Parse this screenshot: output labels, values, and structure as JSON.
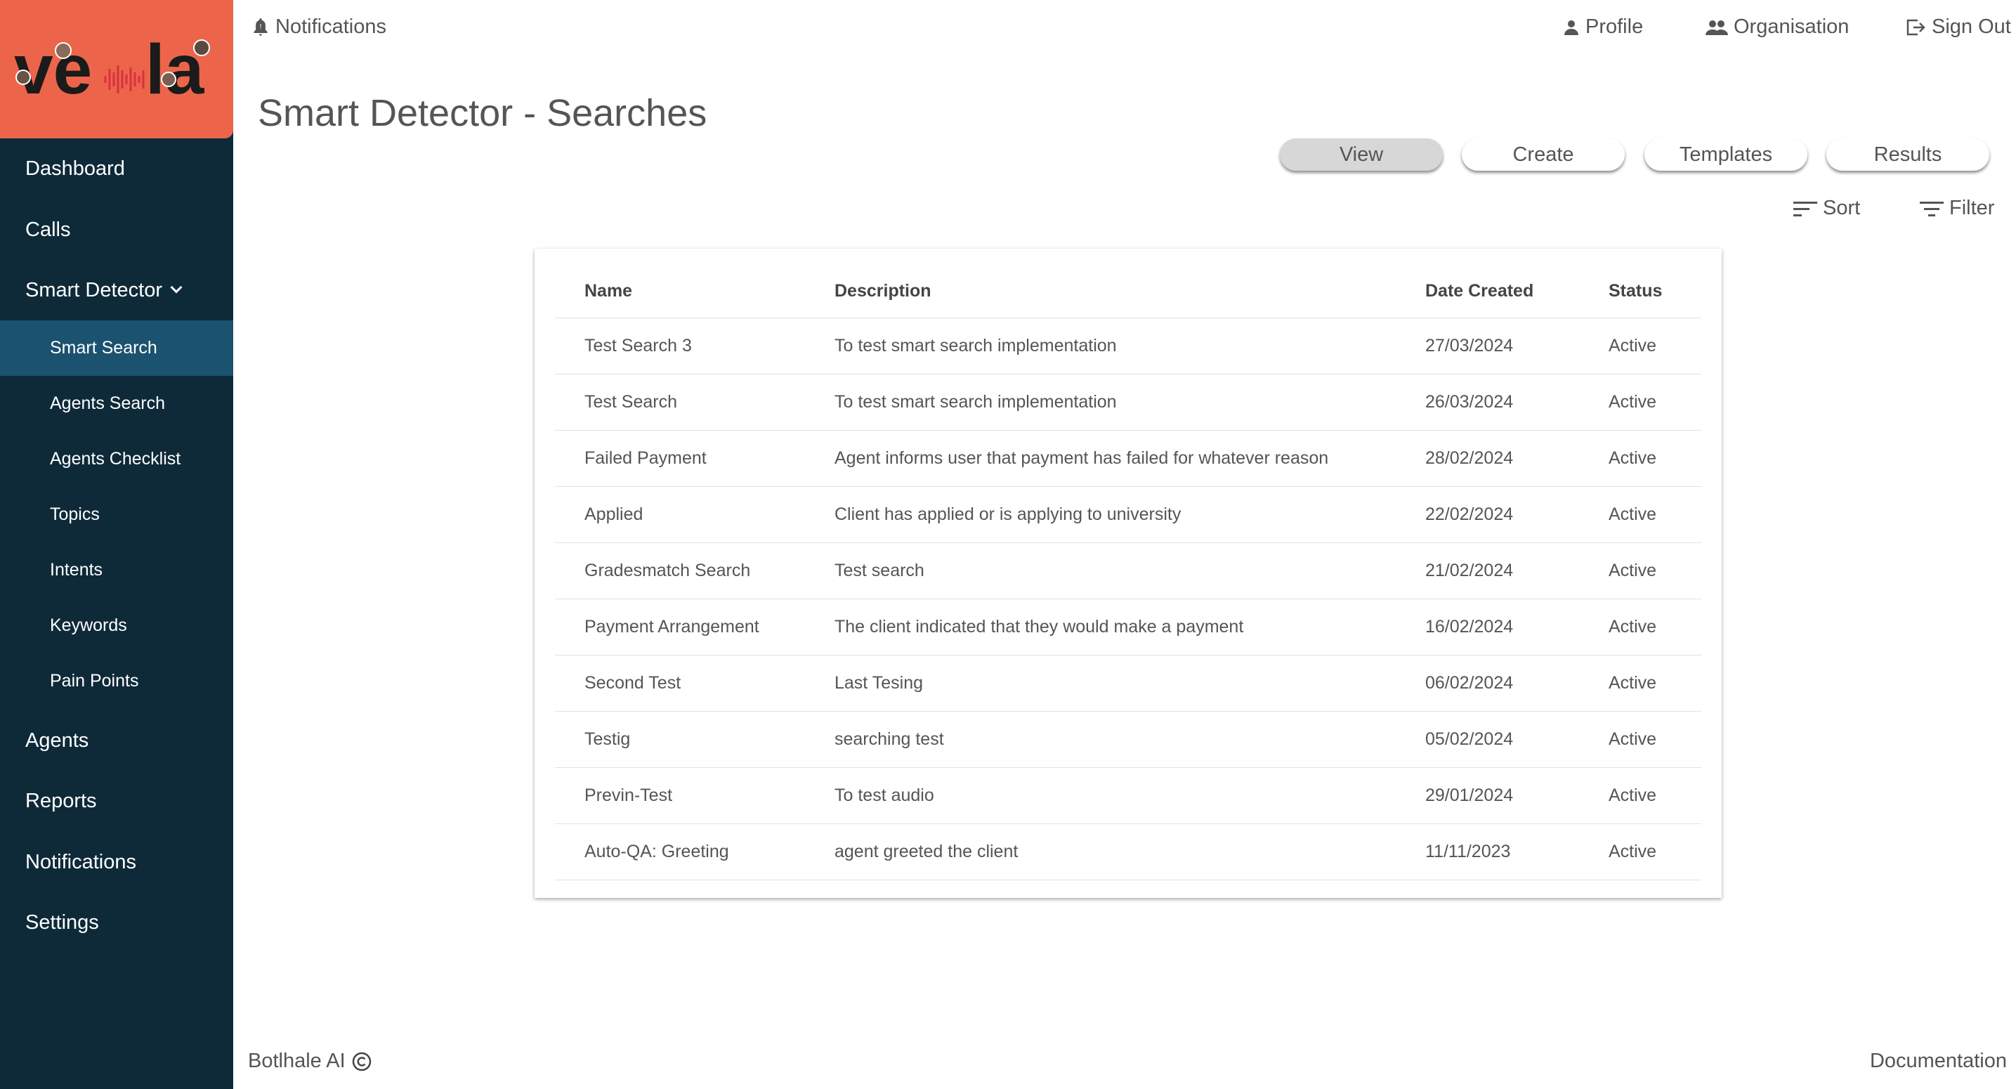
{
  "brand": {
    "logo_text": "vela",
    "logo_color": "#ec654b",
    "sidebar_color": "#0e2a39",
    "active_color": "#1a5270"
  },
  "topbar": {
    "notifications": "Notifications",
    "profile": "Profile",
    "organisation": "Organisation",
    "sign_out": "Sign Out"
  },
  "sidebar": {
    "items": [
      {
        "label": "Dashboard"
      },
      {
        "label": "Calls"
      },
      {
        "label": "Smart Detector"
      },
      {
        "label": "Agents"
      },
      {
        "label": "Reports"
      },
      {
        "label": "Notifications"
      },
      {
        "label": "Settings"
      }
    ],
    "sub_items": [
      {
        "label": "Smart Search",
        "active": true
      },
      {
        "label": "Agents Search"
      },
      {
        "label": "Agents Checklist"
      },
      {
        "label": "Topics"
      },
      {
        "label": "Intents"
      },
      {
        "label": "Keywords"
      },
      {
        "label": "Pain Points"
      }
    ]
  },
  "page": {
    "title": "Smart Detector - Searches"
  },
  "tabs": [
    {
      "label": "View",
      "active": true
    },
    {
      "label": "Create"
    },
    {
      "label": "Templates"
    },
    {
      "label": "Results"
    }
  ],
  "tools": {
    "sort": "Sort",
    "filter": "Filter"
  },
  "table": {
    "columns": [
      "Name",
      "Description",
      "Date Created",
      "Status"
    ],
    "rows": [
      [
        "Test Search 3",
        "To test smart search implementation",
        "27/03/2024",
        "Active"
      ],
      [
        "Test Search",
        "To test smart search implementation",
        "26/03/2024",
        "Active"
      ],
      [
        "Failed Payment",
        "Agent informs user that payment has failed for whatever reason",
        "28/02/2024",
        "Active"
      ],
      [
        "Applied",
        "Client has applied or is applying to university",
        "22/02/2024",
        "Active"
      ],
      [
        "Gradesmatch Search",
        "Test search",
        "21/02/2024",
        "Active"
      ],
      [
        "Payment Arrangement",
        "The client indicated that they would make a payment",
        "16/02/2024",
        "Active"
      ],
      [
        "Second Test",
        "Last Tesing",
        "06/02/2024",
        "Active"
      ],
      [
        "Testig",
        "searching test",
        "05/02/2024",
        "Active"
      ],
      [
        "Previn-Test",
        "To test audio",
        "29/01/2024",
        "Active"
      ],
      [
        "Auto-QA: Greeting",
        "agent greeted the client",
        "11/11/2023",
        "Active"
      ]
    ]
  },
  "footer": {
    "company": "Botlhale AI",
    "documentation": "Documentation"
  }
}
